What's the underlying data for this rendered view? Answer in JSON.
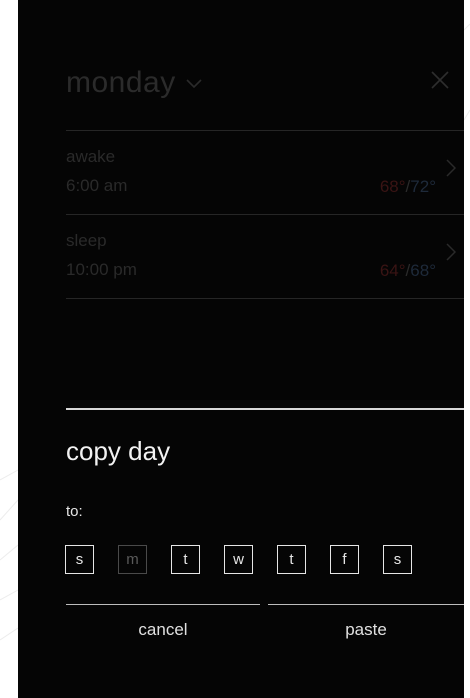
{
  "header": {
    "day": "monday",
    "close_icon": "close-icon",
    "dropdown_icon": "chevron-down-icon"
  },
  "schedule": [
    {
      "label": "awake",
      "time": "6:00 am",
      "heat": "68°",
      "cool": "72°"
    },
    {
      "label": "sleep",
      "time": "10:00 pm",
      "heat": "64°",
      "cool": "68°"
    }
  ],
  "copy_panel": {
    "title": "copy day",
    "to_label": "to:",
    "days": [
      {
        "letter": "s",
        "enabled": true
      },
      {
        "letter": "m",
        "enabled": false
      },
      {
        "letter": "t",
        "enabled": true
      },
      {
        "letter": "w",
        "enabled": true
      },
      {
        "letter": "t",
        "enabled": true
      },
      {
        "letter": "f",
        "enabled": true
      },
      {
        "letter": "s",
        "enabled": true
      }
    ],
    "cancel_label": "cancel",
    "paste_label": "paste"
  },
  "colors": {
    "background": "#050505",
    "heat": "#3a1414",
    "cool": "#1e2a3a",
    "text": "#e6e6e6"
  }
}
